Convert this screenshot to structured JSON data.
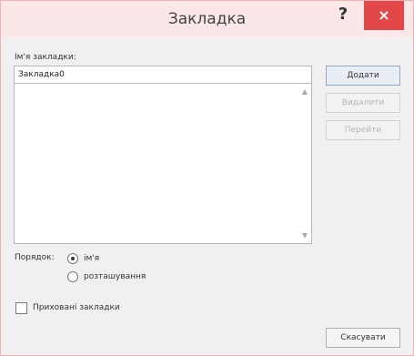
{
  "window": {
    "title": "Закладка",
    "help_label": "?",
    "close_label": "×"
  },
  "name_field": {
    "label": "Ім'я закладки:",
    "value": "Закладка0"
  },
  "buttons": {
    "add": "Додати",
    "delete": "Видалити",
    "goto": "Перейти",
    "cancel": "Скасувати"
  },
  "sort": {
    "label": "Порядок:",
    "options": [
      "ім'я",
      "розташування"
    ],
    "selected": "ім'я"
  },
  "hidden_bookmarks": {
    "label": "Приховані закладки",
    "checked": false
  },
  "icons": {
    "scroll_up": "scroll-up-icon",
    "scroll_down": "scroll-down-icon"
  },
  "colors": {
    "close_button": "#e24848",
    "titlebar": "#fbe7e7"
  }
}
